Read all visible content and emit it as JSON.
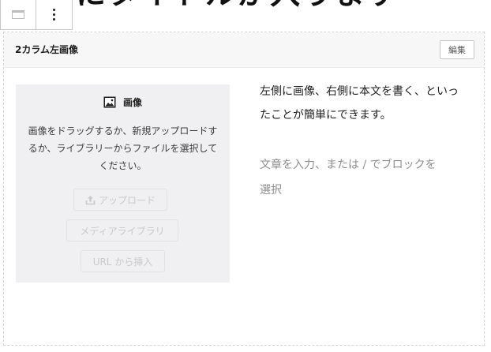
{
  "heading_partial": "ここにタイトルが入ります",
  "toolbar": {
    "block_icon": "block-type-icon",
    "options_icon": "more-options-icon"
  },
  "block": {
    "title": "2カラム左画像",
    "edit_label": "編集"
  },
  "image_placeholder": {
    "title": "画像",
    "icon": "image-icon",
    "instructions": "画像をドラッグするか、新規アップロードするか、ライブラリーからファイルを選択してください。",
    "upload_label": "アップロード",
    "media_library_label": "メディアライブラリ",
    "url_insert_label": "URL から挿入"
  },
  "content": {
    "body": "左側に画像、右側に本文を書く、といったことが簡単にできます。",
    "paragraph_placeholder": "文章を入力、または / でブロックを選択"
  },
  "colors": {
    "placeholder_bg": "#f0f0f2",
    "header_bg": "#f7f7f7",
    "muted_text": "#8d8d8d"
  }
}
